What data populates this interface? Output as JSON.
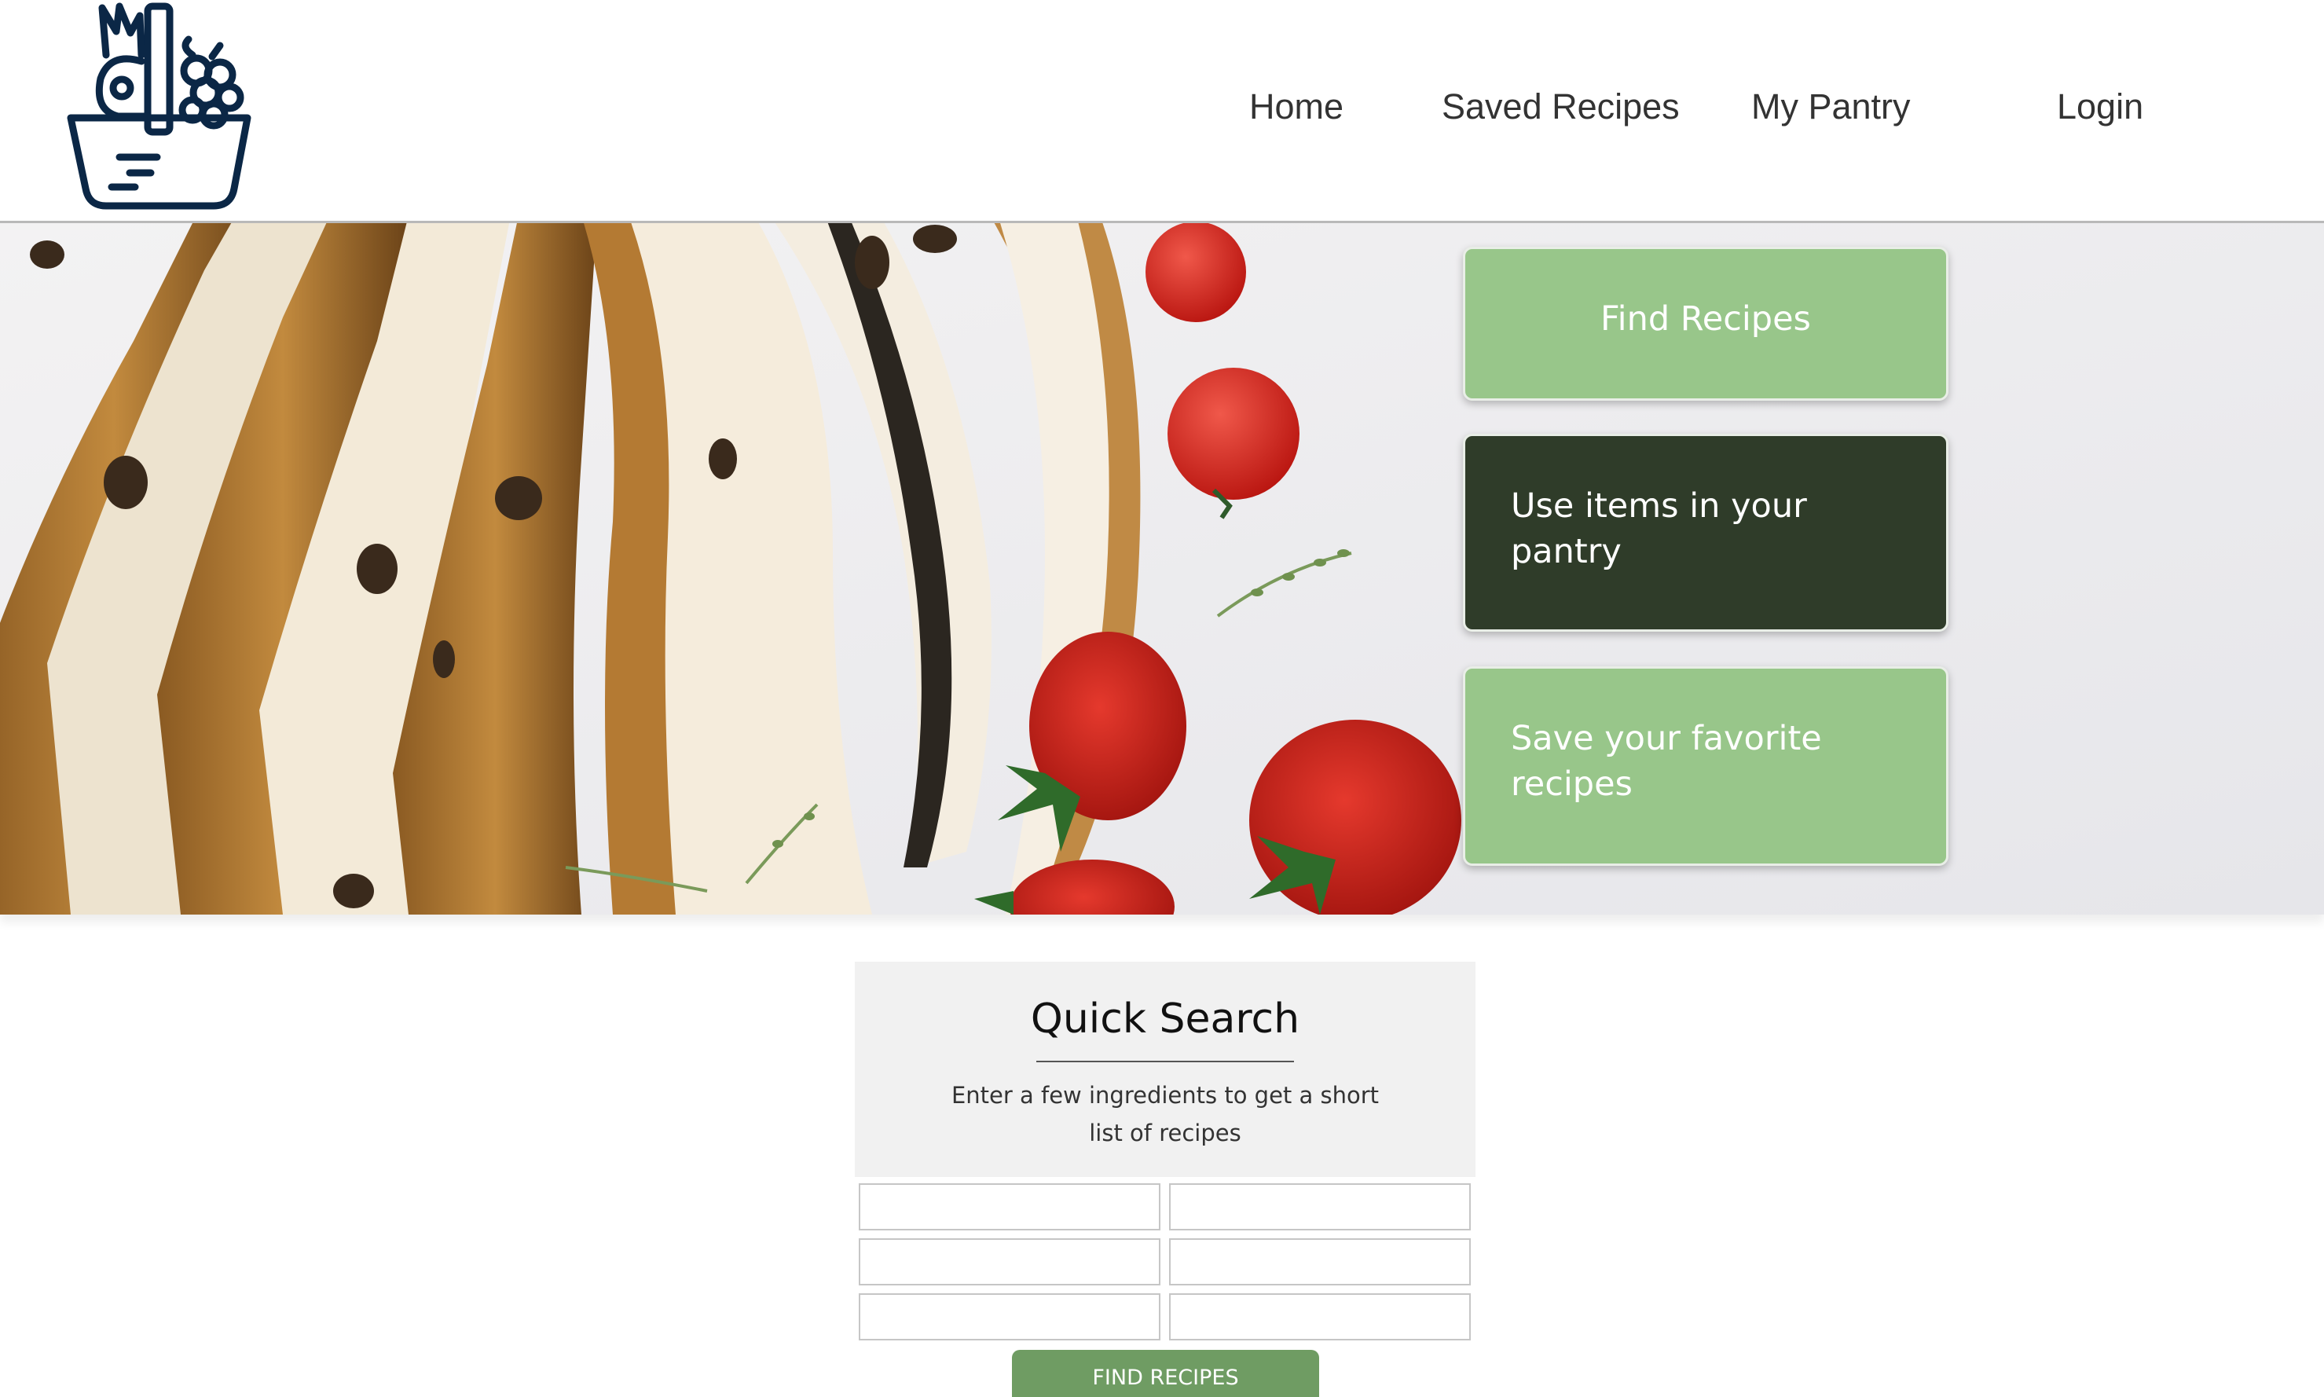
{
  "colors": {
    "brand_dark": "#0b2746",
    "accent_green": "#98c68a",
    "dark_green": "#2f3c29",
    "button_green": "#6f9c63"
  },
  "logo": {
    "icon": "fruit-basket-icon"
  },
  "nav": {
    "home": "Home",
    "saved_recipes": "Saved Recipes",
    "my_pantry": "My Pantry",
    "login": "Login"
  },
  "hero": {
    "card_find": "Find Recipes",
    "card_pantry": "Use items in your pantry",
    "card_save": "Save your favorite recipes"
  },
  "quick_search": {
    "title": "Quick Search",
    "description": "Enter a few ingredients to get a short list of recipes",
    "inputs": [
      "",
      "",
      "",
      "",
      "",
      ""
    ],
    "button": "FIND RECIPES"
  }
}
